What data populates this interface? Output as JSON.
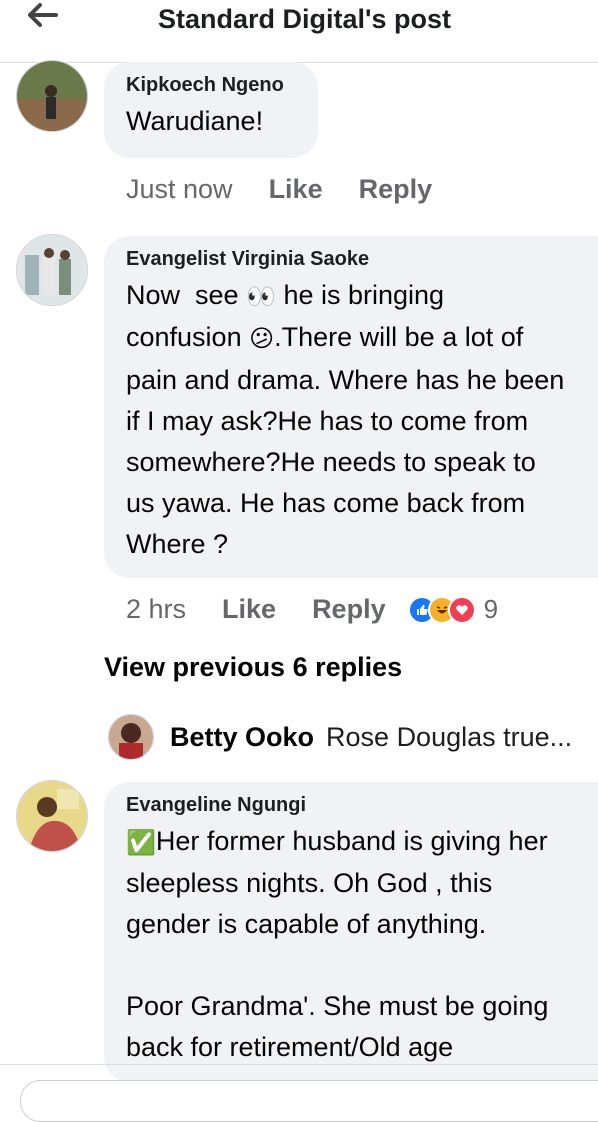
{
  "header": {
    "title": "Standard Digital's post",
    "back_icon": "arrow-left-icon"
  },
  "comments": [
    {
      "author": "Kipkoech Ngeno",
      "text": "Warudiane!",
      "time": "Just now",
      "like_label": "Like",
      "reply_label": "Reply"
    },
    {
      "author": "Evangelist Virginia Saoke",
      "text_parts": {
        "a": "Now  see ",
        "eyes": "👀",
        "b": " he is bringing\nconfusion ",
        "confused": "😕",
        "c": ".There will be a lot of\npain and drama. Where has he been\nif I may ask?He has to come from\nsomewhere?He needs to speak to\nus yawa. He has come back from\nWhere ?"
      },
      "time": "2 hrs",
      "like_label": "Like",
      "reply_label": "Reply",
      "reaction_count": "9",
      "reactions": [
        "like-reaction-icon",
        "haha-reaction-icon",
        "love-reaction-icon"
      ],
      "reaction_colors": {
        "like": "#1877f2",
        "haha": "#f7b125",
        "love": "#f33e58"
      }
    },
    {
      "author": "Evangeline Ngungi",
      "text_parts": {
        "check": "✅",
        "a": "Her former husband is giving her\nsleepless nights. Oh God , this\ngender is capable of anything.\n\nPoor Grandma'. She must be going\nback for retirement/Old age"
      }
    }
  ],
  "view_previous": "View previous 6 replies",
  "latest_reply": {
    "author": "Betty Ooko",
    "text": "Rose Douglas true..."
  }
}
